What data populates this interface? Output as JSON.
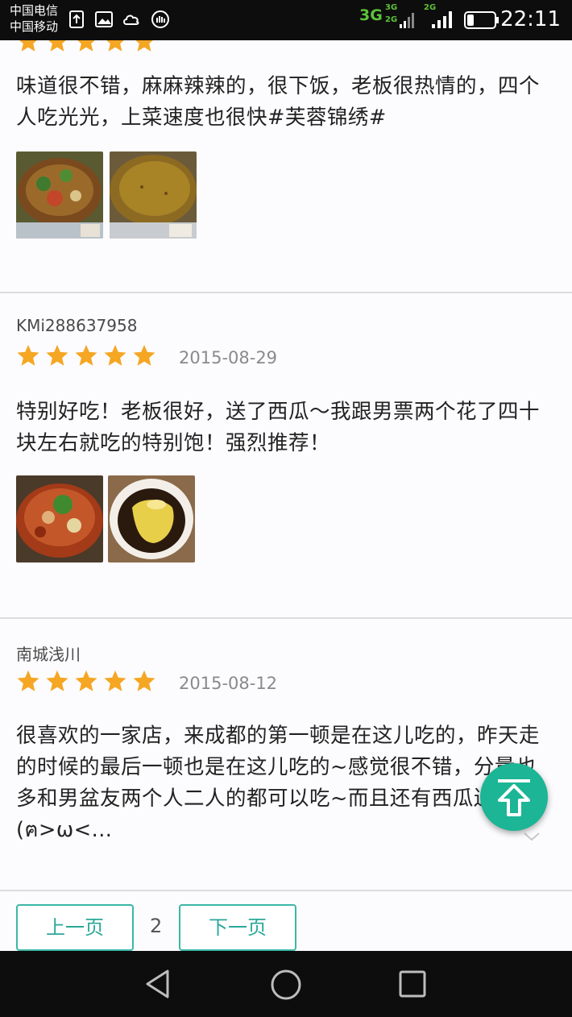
{
  "status_bar": {
    "carrier_1": "中国电信",
    "carrier_2": "中国移动",
    "net_3g": "3G",
    "net_3g_small": "3G",
    "net_2g_small": "2G",
    "net_2g": "2G",
    "time": "22:11"
  },
  "reviews": [
    {
      "text": "味道很不错，麻麻辣辣的，很下饭，老板很热情的，四个人吃光光，上菜速度也很快#芙蓉锦绣#",
      "photos": [
        "food-photo-hotpot",
        "food-photo-broth"
      ]
    },
    {
      "username": "KMi288637958",
      "rating": 5,
      "date": "2015-08-29",
      "text": "特别好吃！老板很好，送了西瓜～我跟男票两个花了四十块左右就吃的特别饱！强烈推荐！",
      "photos": [
        "food-photo-hotpot",
        "food-photo-pudding"
      ]
    },
    {
      "username": "南城浅川",
      "rating": 5,
      "date": "2015-08-12",
      "text": "很喜欢的一家店，来成都的第一顿是在这儿吃的，昨天走的时候的最后一顿也是在这儿吃的~感觉很不错，分量也多和男盆友两个人二人的都可以吃~而且还有西瓜送哦(ฅ>ω<..."
    }
  ],
  "pagination": {
    "prev_label": "上一页",
    "page": "2",
    "next_label": "下一页"
  },
  "colors": {
    "accent": "#2aa898",
    "star": "#f5a623",
    "fab": "#1cb595"
  },
  "icons": [
    "back-icon",
    "home-icon",
    "recents-icon",
    "scroll-top-icon",
    "expand-chevron-icon"
  ]
}
